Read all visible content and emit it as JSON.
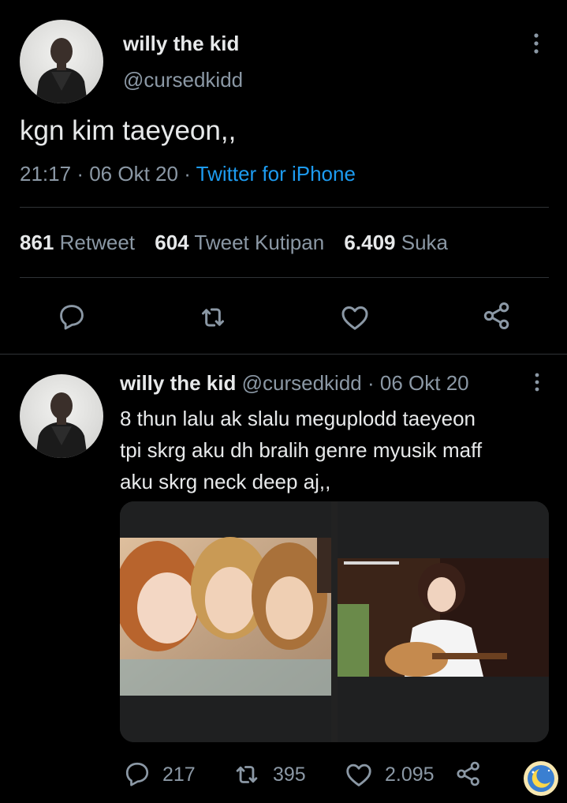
{
  "main_tweet": {
    "author_name": "willy the kid",
    "author_handle": "@cursedkidd",
    "text": "kgn kim taeyeon,,",
    "time": "21:17",
    "sep": "·",
    "date": "06 Okt 20",
    "source": "Twitter for iPhone",
    "stats": {
      "retweets": {
        "count": "861",
        "label": "Retweet"
      },
      "quotes": {
        "count": "604",
        "label": "Tweet Kutipan"
      },
      "likes": {
        "count": "6.409",
        "label": "Suka"
      }
    }
  },
  "reply_tweet": {
    "author_name": "willy the kid",
    "author_handle": "@cursedkidd",
    "sep": "·",
    "date": "06 Okt 20",
    "text_lines": [
      "8 thun lalu ak slalu meguplodd taeyeon",
      "tpi skrg aku dh bralih genre myusik maff",
      "aku skrg neck deep aj,,"
    ],
    "actions": {
      "replies": "217",
      "retweets": "395",
      "likes": "2.095"
    }
  },
  "icons": {
    "more": "more-vertical-icon",
    "reply": "comment-bubble-icon",
    "retweet": "retweet-arrows-icon",
    "like": "heart-icon",
    "share": "share-nodes-icon",
    "badge": "moon-sticker-icon"
  },
  "colors": {
    "background": "#000000",
    "text": "#e7e9ea",
    "secondary": "#8b98a5",
    "link": "#1d9bf0",
    "divider": "#2f3336"
  }
}
